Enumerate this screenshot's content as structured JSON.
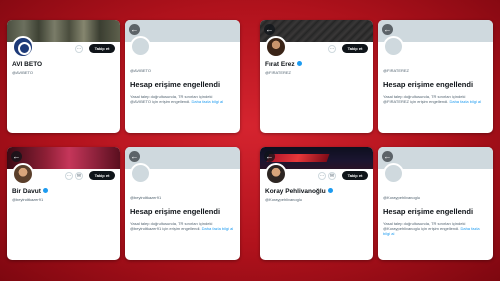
{
  "colors": {
    "background": "#c11b27",
    "card": "#ffffff",
    "banner_placeholder": "#cfd9de",
    "follow_button": "#0f1419",
    "link": "#1d9bf0",
    "verified_badge": "#1d9bf0"
  },
  "icons": {
    "back": "←",
    "more": "⋯",
    "message": "✉",
    "notify": "🔔"
  },
  "panels": [
    {
      "profile": {
        "name": "AVI BETO",
        "handle": "@AVIBETO",
        "follow_label": "Takip et",
        "verified": false
      },
      "withheld": {
        "handle": "@AVIBETO",
        "title": "Hesap erişime engellendi",
        "message": "Yasal talep doğrultusunda, TR sınırları içindeki @AVIBETO için erişim engellendi.",
        "link": "Daha fazla bilgi al"
      }
    },
    {
      "profile": {
        "name": "Fırat Erez",
        "handle": "@FIRATEREZ",
        "follow_label": "Takip et",
        "verified": true
      },
      "withheld": {
        "handle": "@FIRATEREZ",
        "title": "Hesap erişime engellendi",
        "message": "Yasal talep doğrultusunda, TR sınırları içindeki @FIRATEREZ için erişim engellendi.",
        "link": "Daha fazla bilgi al"
      }
    },
    {
      "profile": {
        "name": "Bir Davut",
        "handle": "@beyindtkazer91",
        "follow_label": "Takip et",
        "verified": true
      },
      "withheld": {
        "handle": "@beyindtkazer91",
        "title": "Hesap erişime engellendi",
        "message": "Yasal talep doğrultusunda, TR sınırları içindeki @beyindtkazer91 için erişim engellendi.",
        "link": "Daha fazla bilgi al"
      }
    },
    {
      "profile": {
        "name": "Koray Pehlivanoğlu",
        "handle": "@Koraypehlivanoglu",
        "follow_label": "Takip et",
        "verified": true
      },
      "withheld": {
        "handle": "@Koraypehlivanoglu",
        "title": "Hesap erişime engellendi",
        "message": "Yasal talep doğrultusunda, TR sınırları içindeki @Koraypehlivanoglu için erişim engellendi.",
        "link": "Daha fazla bilgi al"
      }
    }
  ]
}
